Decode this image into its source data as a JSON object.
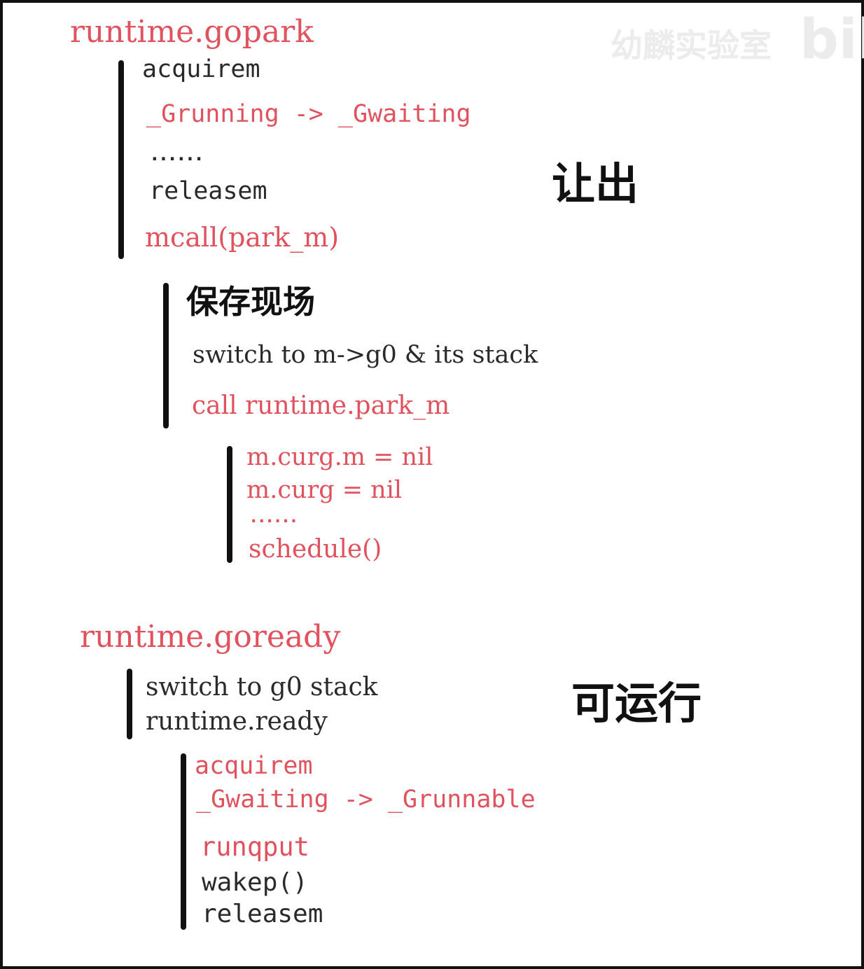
{
  "watermark": {
    "channel": "幼麟实验室",
    "logo": "bili"
  },
  "gopark": {
    "title": "runtime.gopark",
    "steps": {
      "acquirem": "acquirem",
      "transition": "_Grunning -> _Gwaiting",
      "ellipsis": "......",
      "releasem": "releasem",
      "mcall": "mcall(park_m)"
    },
    "label": "让出",
    "mcall_body": {
      "save": "保存现场",
      "switch": "switch to m->g0 & its stack",
      "call": "call runtime.park_m"
    },
    "park_m_body": {
      "line1": "m.curg.m = nil",
      "line2": "m.curg = nil",
      "ellipsis": "......",
      "schedule": "schedule()"
    }
  },
  "goready": {
    "title": "runtime.goready",
    "steps": {
      "switch": "switch to g0 stack",
      "ready": "runtime.ready"
    },
    "label": "可运行",
    "ready_body": {
      "acquirem": "acquirem",
      "transition": "_Gwaiting -> _Grunnable",
      "runqput": "runqput",
      "wakep": "wakep()",
      "releasem": "releasem"
    }
  }
}
